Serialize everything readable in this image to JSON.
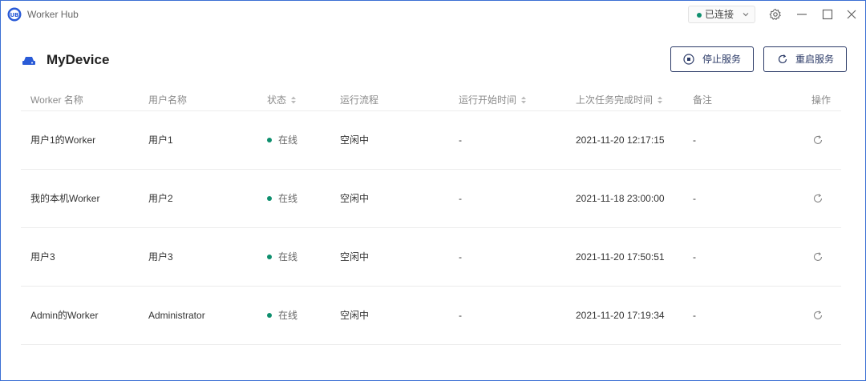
{
  "window": {
    "title": "Worker Hub"
  },
  "connection": {
    "label": "已连接",
    "status_color": "#0e8f6e"
  },
  "header": {
    "title": "MyDevice",
    "stop_label": "停止服务",
    "restart_label": "重启服务"
  },
  "table": {
    "columns": {
      "name": "Worker 名称",
      "user": "用户名称",
      "status": "状态",
      "flow": "运行流程",
      "start": "运行开始时间",
      "last": "上次任务完成时间",
      "note": "备注",
      "ops": "操作"
    },
    "rows": [
      {
        "name": "用户1的Worker",
        "user": "用户1",
        "status": "在线",
        "flow": "空闲中",
        "start": "-",
        "last": "2021-11-20 12:17:15",
        "note": "-"
      },
      {
        "name": "我的本机Worker",
        "user": "用户2",
        "status": "在线",
        "flow": "空闲中",
        "start": "-",
        "last": "2021-11-18 23:00:00",
        "note": "-"
      },
      {
        "name": "用户3",
        "user": "用户3",
        "status": "在线",
        "flow": "空闲中",
        "start": "-",
        "last": "2021-11-20 17:50:51",
        "note": "-"
      },
      {
        "name": "Admin的Worker",
        "user": "Administrator",
        "status": "在线",
        "flow": "空闲中",
        "start": "-",
        "last": "2021-11-20 17:19:34",
        "note": "-"
      }
    ]
  },
  "icons": {
    "app": "worker-hub-logo-icon",
    "device": "device-icon",
    "stop": "stop-circle-icon",
    "restart": "refresh-icon",
    "settings": "gear-icon",
    "minimize": "minimize-icon",
    "maximize": "maximize-icon",
    "close": "close-icon"
  },
  "colors": {
    "accent": "#2b3a67",
    "online": "#0e8f6e",
    "window_border": "#3b6fd4"
  }
}
